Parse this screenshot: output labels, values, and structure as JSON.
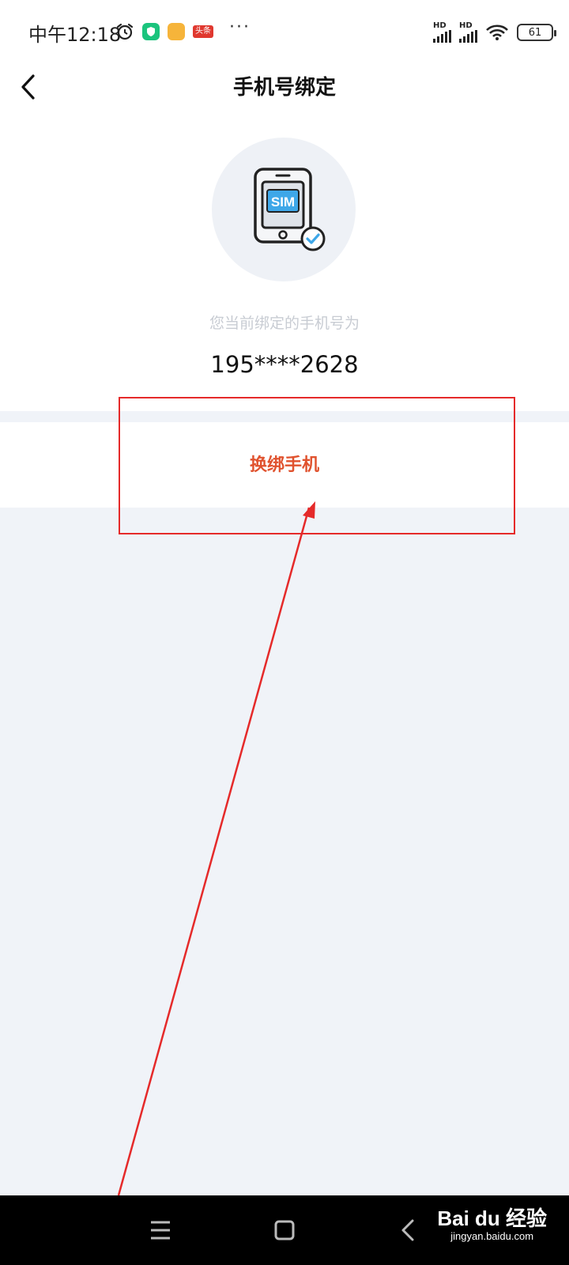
{
  "status_bar": {
    "time": "中午12:18",
    "app_badge_label": "头条",
    "more": "···",
    "signal_1_label": "HD",
    "signal_2_label": "HD",
    "battery_level": "61"
  },
  "header": {
    "title": "手机号绑定"
  },
  "main": {
    "sim_label": "SIM",
    "bound_label": "您当前绑定的手机号为",
    "phone_number": "195****2628",
    "rebind_button": "换绑手机"
  },
  "watermark": {
    "logo": "Bai du 经验",
    "url": "jingyan.baidu.com"
  },
  "colors": {
    "accent": "#e0522e",
    "annotation": "#e52a2a",
    "page_background": "#f0f3f8"
  }
}
